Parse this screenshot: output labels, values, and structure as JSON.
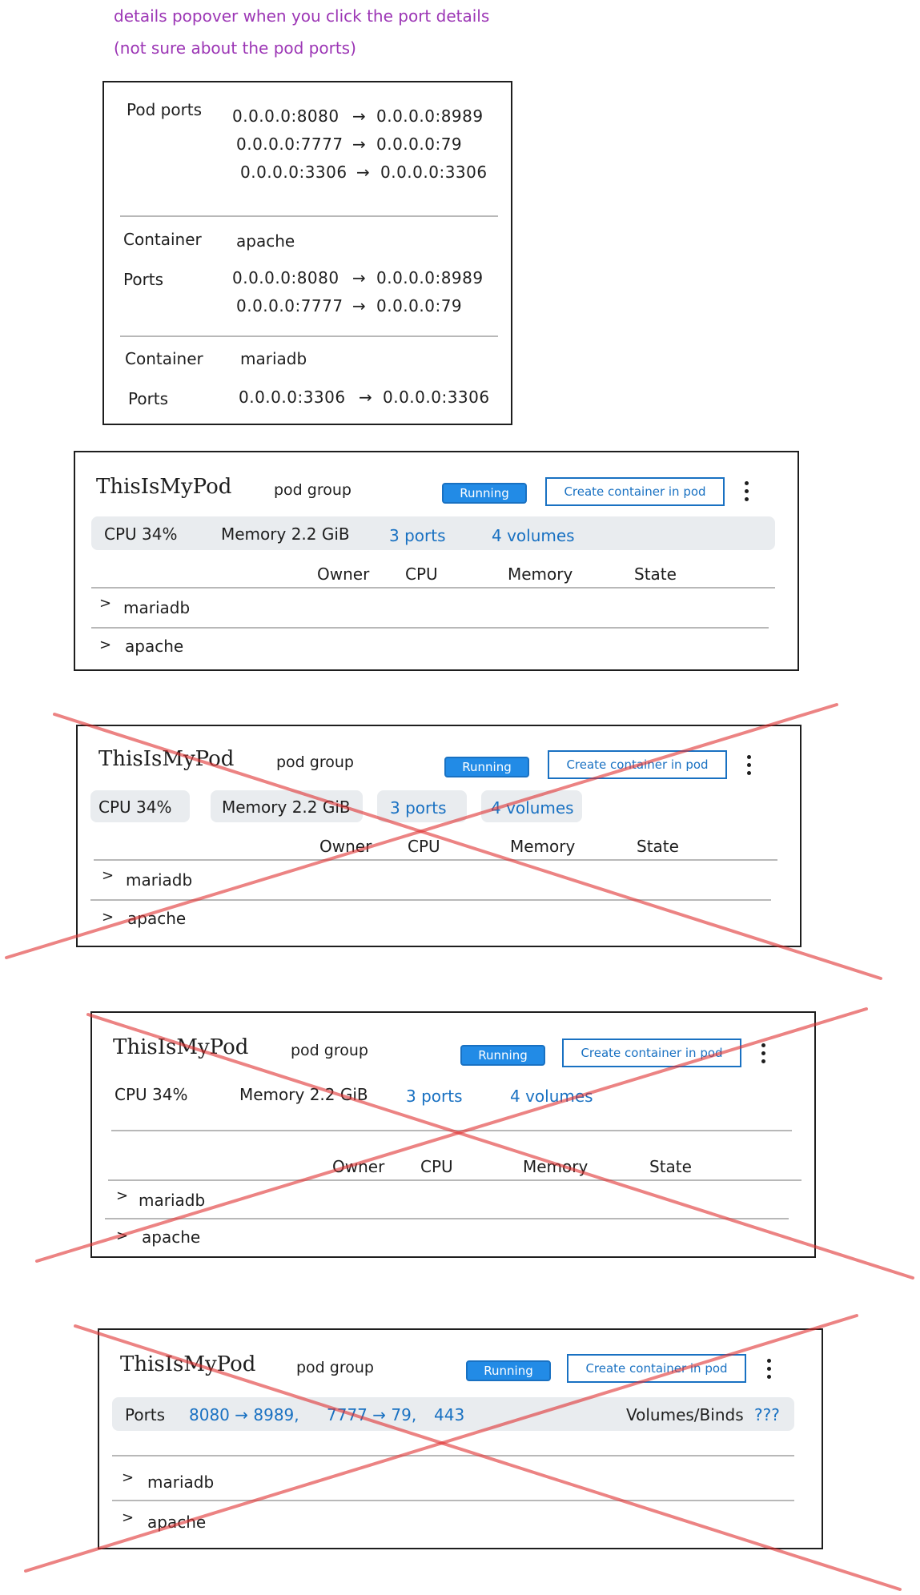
{
  "notes": {
    "line1": "details popover when you click the port details",
    "line2": "(not sure about the pod ports)"
  },
  "popover": {
    "pod_ports_label": "Pod ports",
    "pod_ports": [
      {
        "from": "0.0.0.0:8080",
        "arrow": "→",
        "to": "0.0.0.0:8989"
      },
      {
        "from": "0.0.0.0:7777",
        "arrow": "→",
        "to": "0.0.0.0:79"
      },
      {
        "from": "0.0.0.0:3306",
        "arrow": "→",
        "to": "0.0.0.0:3306"
      }
    ],
    "containers": [
      {
        "container_label": "Container",
        "name": "apache",
        "ports_label": "Ports",
        "ports": [
          {
            "from": "0.0.0.0:8080",
            "arrow": "→",
            "to": "0.0.0.0:8989"
          },
          {
            "from": "0.0.0.0:7777",
            "arrow": "→",
            "to": "0.0.0.0:79"
          }
        ]
      },
      {
        "container_label": "Container",
        "name": "mariadb",
        "ports_label": "Ports",
        "ports": [
          {
            "from": "0.0.0.0:3306",
            "arrow": "→",
            "to": "0.0.0.0:3306"
          }
        ]
      }
    ]
  },
  "pod_cards": [
    {
      "title": "ThisIsMyPod",
      "group": "pod group",
      "status": "Running",
      "create_button": "Create container in pod",
      "cpu": "CPU 34%",
      "memory": "Memory 2.2 GiB",
      "ports": "3 ports",
      "volumes": "4 volumes",
      "columns": [
        "Owner",
        "CPU",
        "Memory",
        "State"
      ],
      "rows": [
        {
          "chevron": ">",
          "name": "mariadb"
        },
        {
          "chevron": ">",
          "name": "apache"
        }
      ],
      "crossed_out": false
    },
    {
      "title": "ThisIsMyPod",
      "group": "pod group",
      "status": "Running",
      "create_button": "Create container in pod",
      "cpu": "CPU 34%",
      "memory": "Memory 2.2 GiB",
      "ports": "3 ports",
      "volumes": "4 volumes",
      "columns": [
        "Owner",
        "CPU",
        "Memory",
        "State"
      ],
      "rows": [
        {
          "chevron": ">",
          "name": "mariadb"
        },
        {
          "chevron": ">",
          "name": "apache"
        }
      ],
      "crossed_out": true
    },
    {
      "title": "ThisIsMyPod",
      "group": "pod group",
      "status": "Running",
      "create_button": "Create container in pod",
      "cpu": "CPU 34%",
      "memory": "Memory 2.2 GiB",
      "ports": "3 ports",
      "volumes": "4 volumes",
      "columns": [
        "Owner",
        "CPU",
        "Memory",
        "State"
      ],
      "rows": [
        {
          "chevron": ">",
          "name": "mariadb"
        },
        {
          "chevron": ">",
          "name": "apache"
        }
      ],
      "crossed_out": true
    },
    {
      "title": "ThisIsMyPod",
      "group": "pod group",
      "status": "Running",
      "create_button": "Create container in pod",
      "ports_label": "Ports",
      "port_links": [
        "8080 → 8989,",
        "7777 → 79,",
        "443"
      ],
      "volumes_label": "Volumes/Binds",
      "volumes_value": "???",
      "rows": [
        {
          "chevron": ">",
          "name": "mariadb"
        },
        {
          "chevron": ">",
          "name": "apache"
        }
      ],
      "crossed_out": true
    }
  ],
  "colors": {
    "note": "#9c36b5",
    "accent": "#228be6",
    "link": "#1971c2",
    "strike": "#e03131",
    "strip": "#e9ecef",
    "ink": "#1e1e1e"
  }
}
